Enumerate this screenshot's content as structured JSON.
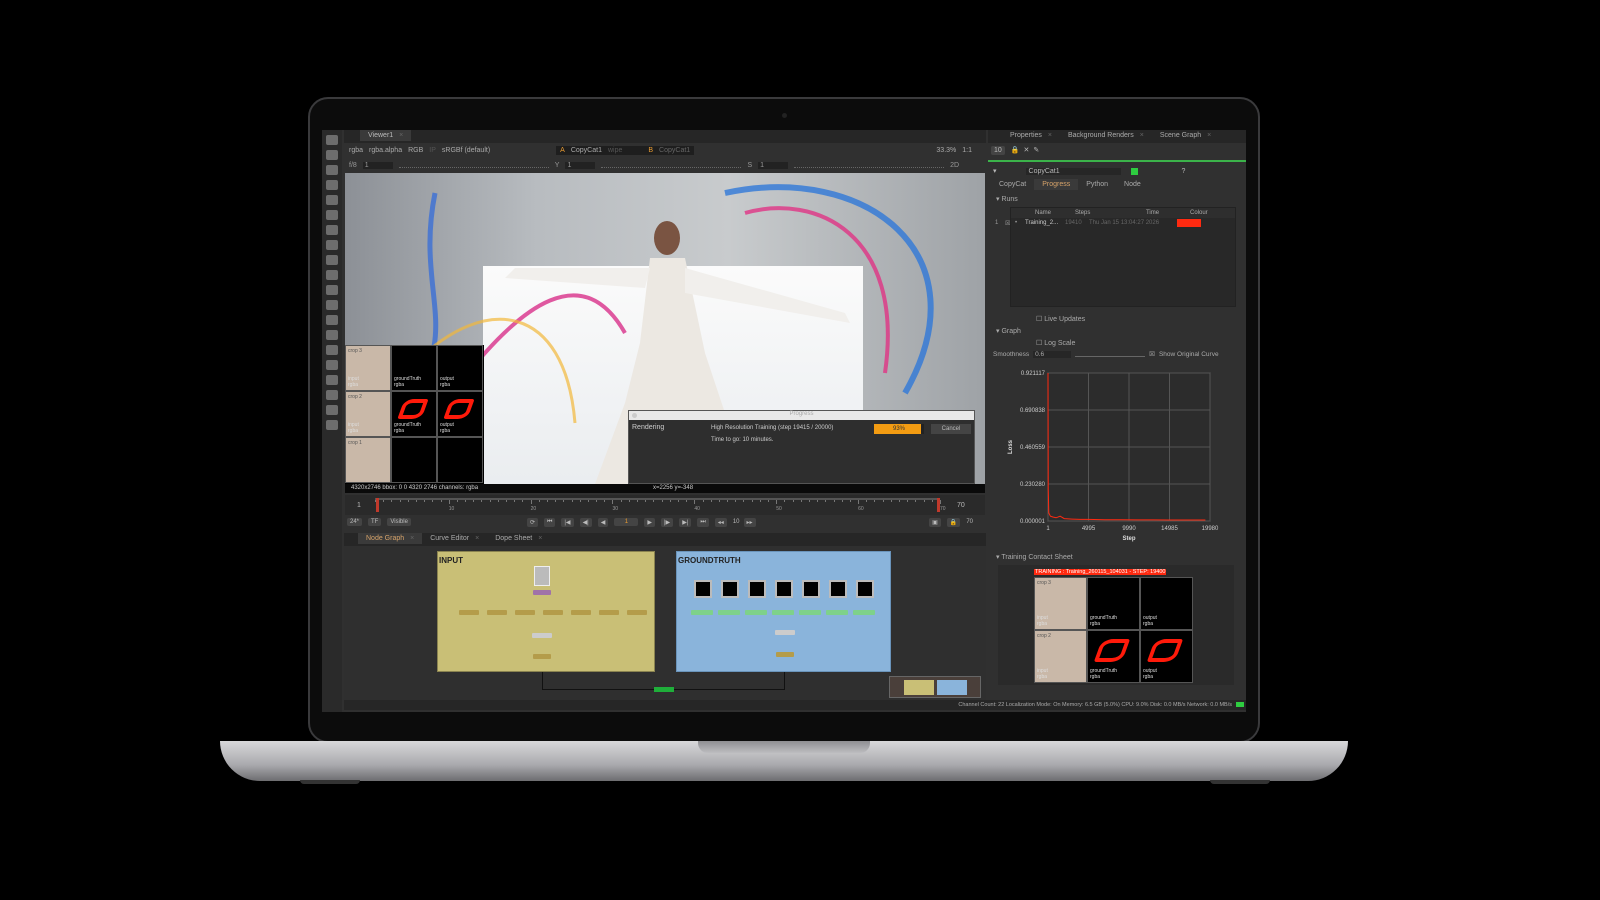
{
  "viewer": {
    "tab": "Viewer1",
    "channels": "rgba",
    "alpha": "rgba.alpha",
    "display": "RGB",
    "ip": "IP",
    "lut": "sRGBf (default)",
    "input_a_label": "A",
    "input_a": "CopyCat1",
    "wipe": "wipe",
    "input_b_label": "B",
    "input_b": "CopyCat1",
    "zoom": "33.3%",
    "ratio": "1:1",
    "fstop": "f/8",
    "gain": "1",
    "gamma_label": "Y",
    "gamma": "1",
    "sat_label": "S",
    "sat": "1",
    "view_mode": "2D",
    "info": "4320x2746  bbox: 0 0 4320 2746 channels: rgba",
    "coords": "x=2256 y=-348"
  },
  "overlay_sheet": {
    "rows": [
      {
        "crop": "crop 3",
        "cells": [
          [
            "input",
            "rgba"
          ],
          [
            "groundTruth",
            "rgba"
          ],
          [
            "output",
            "rgba"
          ]
        ]
      },
      {
        "crop": "crop 2",
        "cells": [
          [
            "input",
            "rgba"
          ],
          [
            "groundTruth",
            "rgba"
          ],
          [
            "output",
            "rgba"
          ]
        ]
      },
      {
        "crop": "crop 1",
        "cells": [
          [
            "",
            ""
          ],
          [
            "",
            ""
          ],
          [
            "",
            ""
          ]
        ]
      }
    ]
  },
  "progress_dialog": {
    "title": "Progress",
    "label": "Rendering",
    "task": "High Resolution Training (step 19415 / 20000)",
    "eta": "Time to go: 10 minutes.",
    "percent": 93,
    "percent_text": "93%",
    "cancel": "Cancel"
  },
  "timeline": {
    "start": "1",
    "end": "70",
    "end2": "70",
    "ticks": [
      "1",
      "10",
      "20",
      "30",
      "40",
      "50",
      "60",
      "70"
    ],
    "current": "1",
    "fps": "24*",
    "tf": "TF",
    "visible": "Visible",
    "step": "10"
  },
  "node_graph": {
    "tabs": [
      "Node Graph",
      "Curve Editor",
      "Dope Sheet"
    ],
    "backdrops": [
      "INPUT",
      "GROUNDTRUTH"
    ]
  },
  "status_bar": "Channel Count: 22  Localization Mode: On  Memory: 6.5 GB (5.0%)  CPU: 9.0%  Disk: 0.0 MB/s  Network: 0.0 MB/s",
  "properties": {
    "tabs": [
      "Properties",
      "Background Renders",
      "Scene Graph"
    ],
    "max_panels": "10",
    "node_name": "CopyCat1",
    "node_tabs": [
      "CopyCat",
      "Progress",
      "Python",
      "Node"
    ],
    "runs_section": "Runs",
    "runs_columns": [
      "Name",
      "Steps",
      "Time",
      "Colour"
    ],
    "runs": [
      {
        "index": "1",
        "name": "Training_2...",
        "steps": "19410",
        "time": "Thu Jan 15 13:04:27 2026",
        "colour": "#ff2a10"
      }
    ],
    "live_updates": "Live Updates",
    "graph_section": "Graph",
    "log_scale": "Log Scale",
    "smoothness_label": "Smoothness",
    "smoothness": "0.6",
    "show_original": "Show Original Curve",
    "contact_section": "Training Contact Sheet",
    "contact_title": "TRAINING : Training_260115_104031 - STEP: 19400",
    "contact_rows": [
      {
        "crop": "crop 3",
        "cells": [
          [
            "input",
            "rgba"
          ],
          [
            "groundTruth",
            "rgba"
          ],
          [
            "output",
            "rgba"
          ]
        ]
      },
      {
        "crop": "crop 2",
        "cells": [
          [
            "input",
            "rgba"
          ],
          [
            "groundTruth",
            "rgba"
          ],
          [
            "output",
            "rgba"
          ]
        ]
      }
    ]
  },
  "chart_data": {
    "type": "line",
    "xlabel": "Step",
    "ylabel": "Loss",
    "x_ticks": [
      "1",
      "4995",
      "9990",
      "14985",
      "19980"
    ],
    "y_ticks": [
      "0.000001",
      "0.230280",
      "0.460559",
      "0.690838",
      "0.921117"
    ],
    "xlim": [
      1,
      19980
    ],
    "ylim": [
      1e-06,
      0.921117
    ],
    "series": [
      {
        "name": "Training_2",
        "color": "#ff2a10",
        "x": [
          1,
          30,
          100,
          300,
          600,
          1000,
          1500,
          2000,
          3000,
          4000,
          5000,
          7000,
          9000,
          11000,
          13000,
          15000,
          17000,
          19410
        ],
        "y": [
          0.921,
          0.2,
          0.05,
          0.03,
          0.025,
          0.02,
          0.03,
          0.015,
          0.012,
          0.01,
          0.01,
          0.008,
          0.008,
          0.007,
          0.007,
          0.006,
          0.006,
          0.006
        ]
      }
    ]
  }
}
